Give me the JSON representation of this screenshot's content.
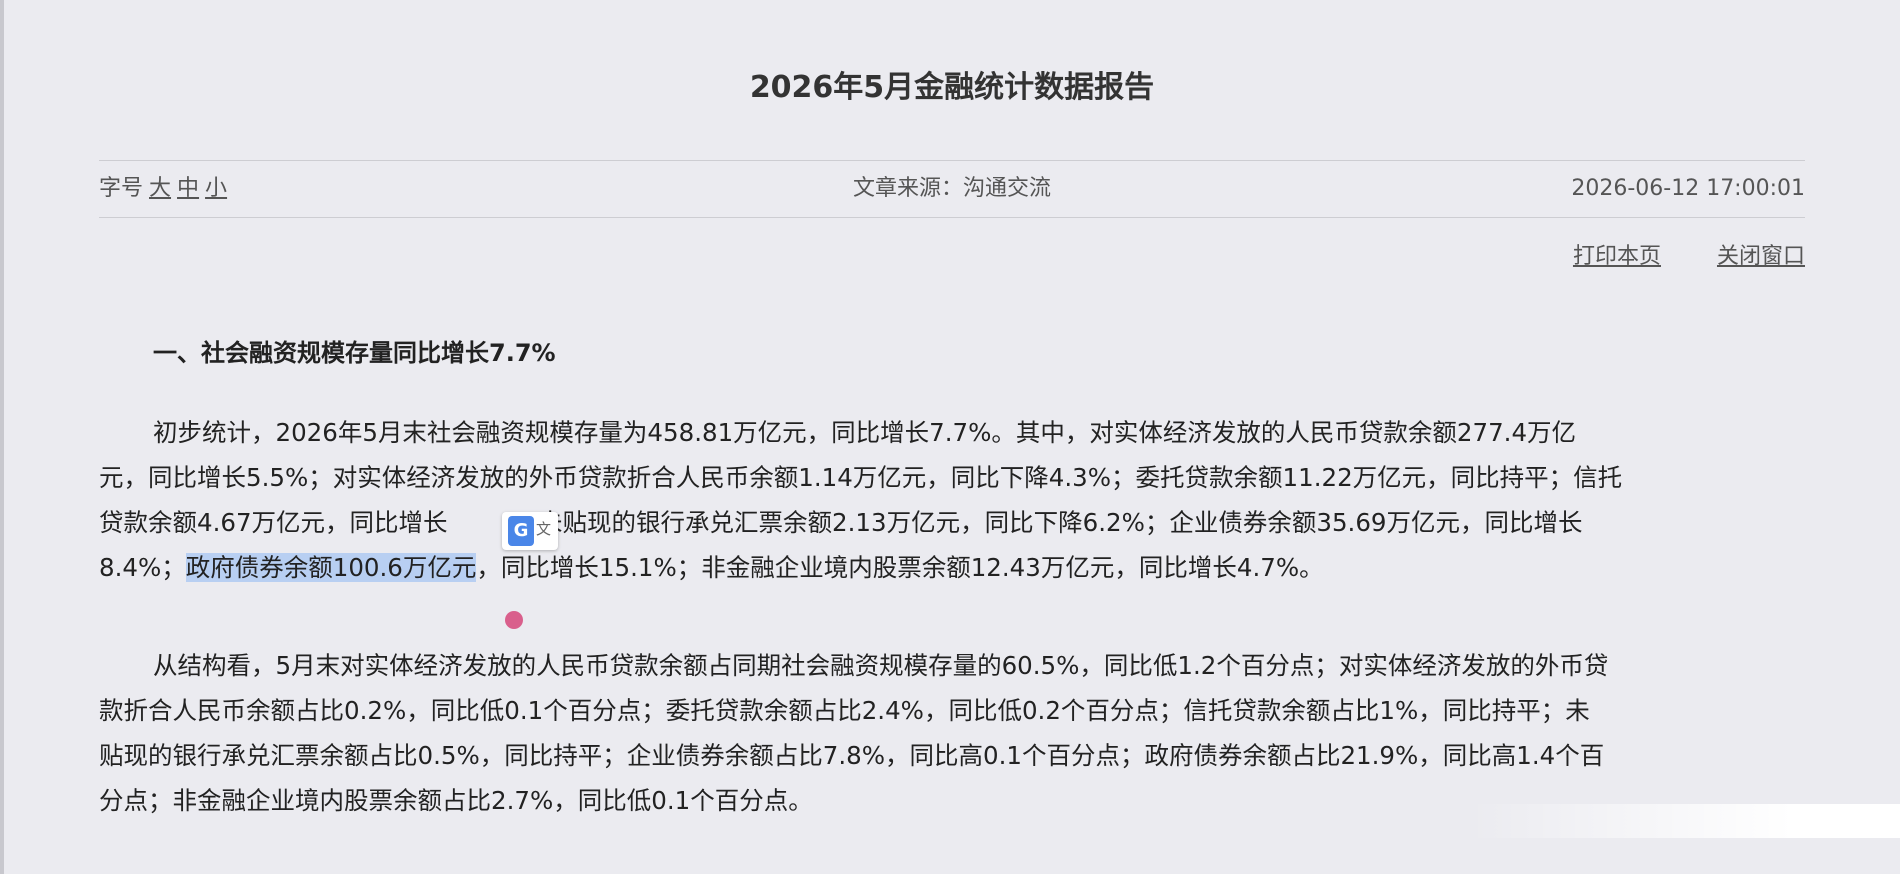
{
  "article": {
    "title": "2026年5月金融统计数据报告",
    "fontsize_label": "字号",
    "fontsize_options": [
      "大",
      "中",
      "小"
    ],
    "source_label": "文章来源：沟通交流",
    "datetime": "2026-06-12 17:00:01",
    "print_label": "打印本页",
    "close_label": "关闭窗口",
    "section_heading": "一、社会融资规模存量同比增长7.7%",
    "para1": {
      "line1": "初步统计，2026年5月末社会融资规模存量为458.81万亿元，同比增长7.7%。其中，对实体经济发放的人民币贷款余额277.4万亿",
      "line2": "元，同比增长5.5%；对实体经济发放的外币贷款折合人民币余额1.14万亿元，同比下降4.3%；委托贷款余额11.22万亿元，同比持平；信托",
      "line3_before": "贷款余额4.67万亿元，同比增长",
      "line3_after": "；未贴现的银行承兑汇票余额2.13万亿元，同比下降6.2%；企业债券余额35.69万亿元，同比增长",
      "line4_before": "8.4%；",
      "line4_highlight": "政府债券余额100.6万亿元",
      "line4_after": "，同比增长15.1%；非金融企业境内股票余额12.43万亿元，同比增长4.7%。"
    },
    "para2": {
      "line1": "从结构看，5月末对实体经济发放的人民币贷款余额占同期社会融资规模存量的60.5%，同比低1.2个百分点；对实体经济发放的外币贷",
      "line2": "款折合人民币余额占比0.2%，同比低0.1个百分点；委托贷款余额占比2.4%，同比低0.2个百分点；信托贷款余额占比1%，同比持平；未",
      "line3": "贴现的银行承兑汇票余额占比0.5%，同比持平；企业债券余额占比7.8%，同比高0.1个百分点；政府债券余额占比21.9%，同比高1.4个百",
      "line4": "分点；非金融企业境内股票余额占比2.7%，同比低0.1个百分点。"
    }
  },
  "translate_popup": {
    "icon": "google-translate-icon",
    "g_letter": "G",
    "wen_char": "文"
  },
  "colors": {
    "background": "#ebebf0",
    "highlight": "#b8cff2",
    "translate_blue": "#4a86e8",
    "pin": "#d95f8c"
  }
}
